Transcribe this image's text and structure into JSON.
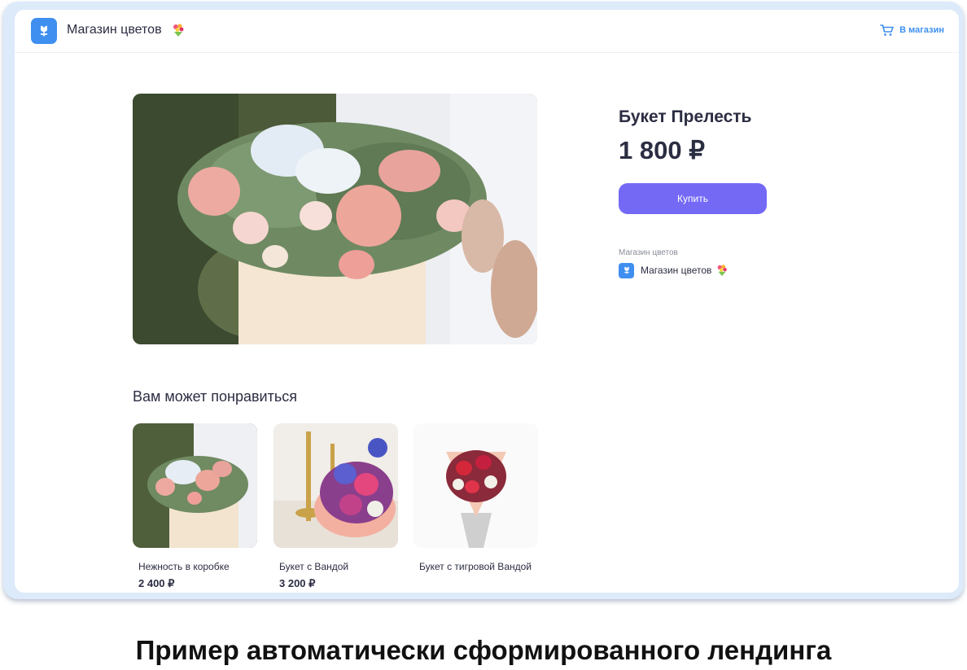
{
  "header": {
    "store_name": "Магазин цветов",
    "cart_label": "В магазин",
    "logo_icon": "flower-icon",
    "cart_icon": "cart-icon"
  },
  "product": {
    "name": "Букет Прелесть",
    "price": "1 800 ₽",
    "buy_label": "Купить"
  },
  "seller": {
    "caption": "Магазин цветов",
    "name": "Магазин цветов"
  },
  "recommendations": {
    "title": "Вам может понравиться",
    "items": [
      {
        "name": "Нежность в коробке",
        "price": "2 400 ₽"
      },
      {
        "name": "Букет с Вандой",
        "price": "3 200 ₽"
      },
      {
        "name": "Букет с тигровой Вандой",
        "price": ""
      }
    ]
  },
  "caption": "Пример автоматически сформированного лендинга",
  "colors": {
    "accent": "#3f8ff0",
    "buy_button": "#7469f5",
    "frame": "#dceafa",
    "text": "#2b2d42"
  }
}
